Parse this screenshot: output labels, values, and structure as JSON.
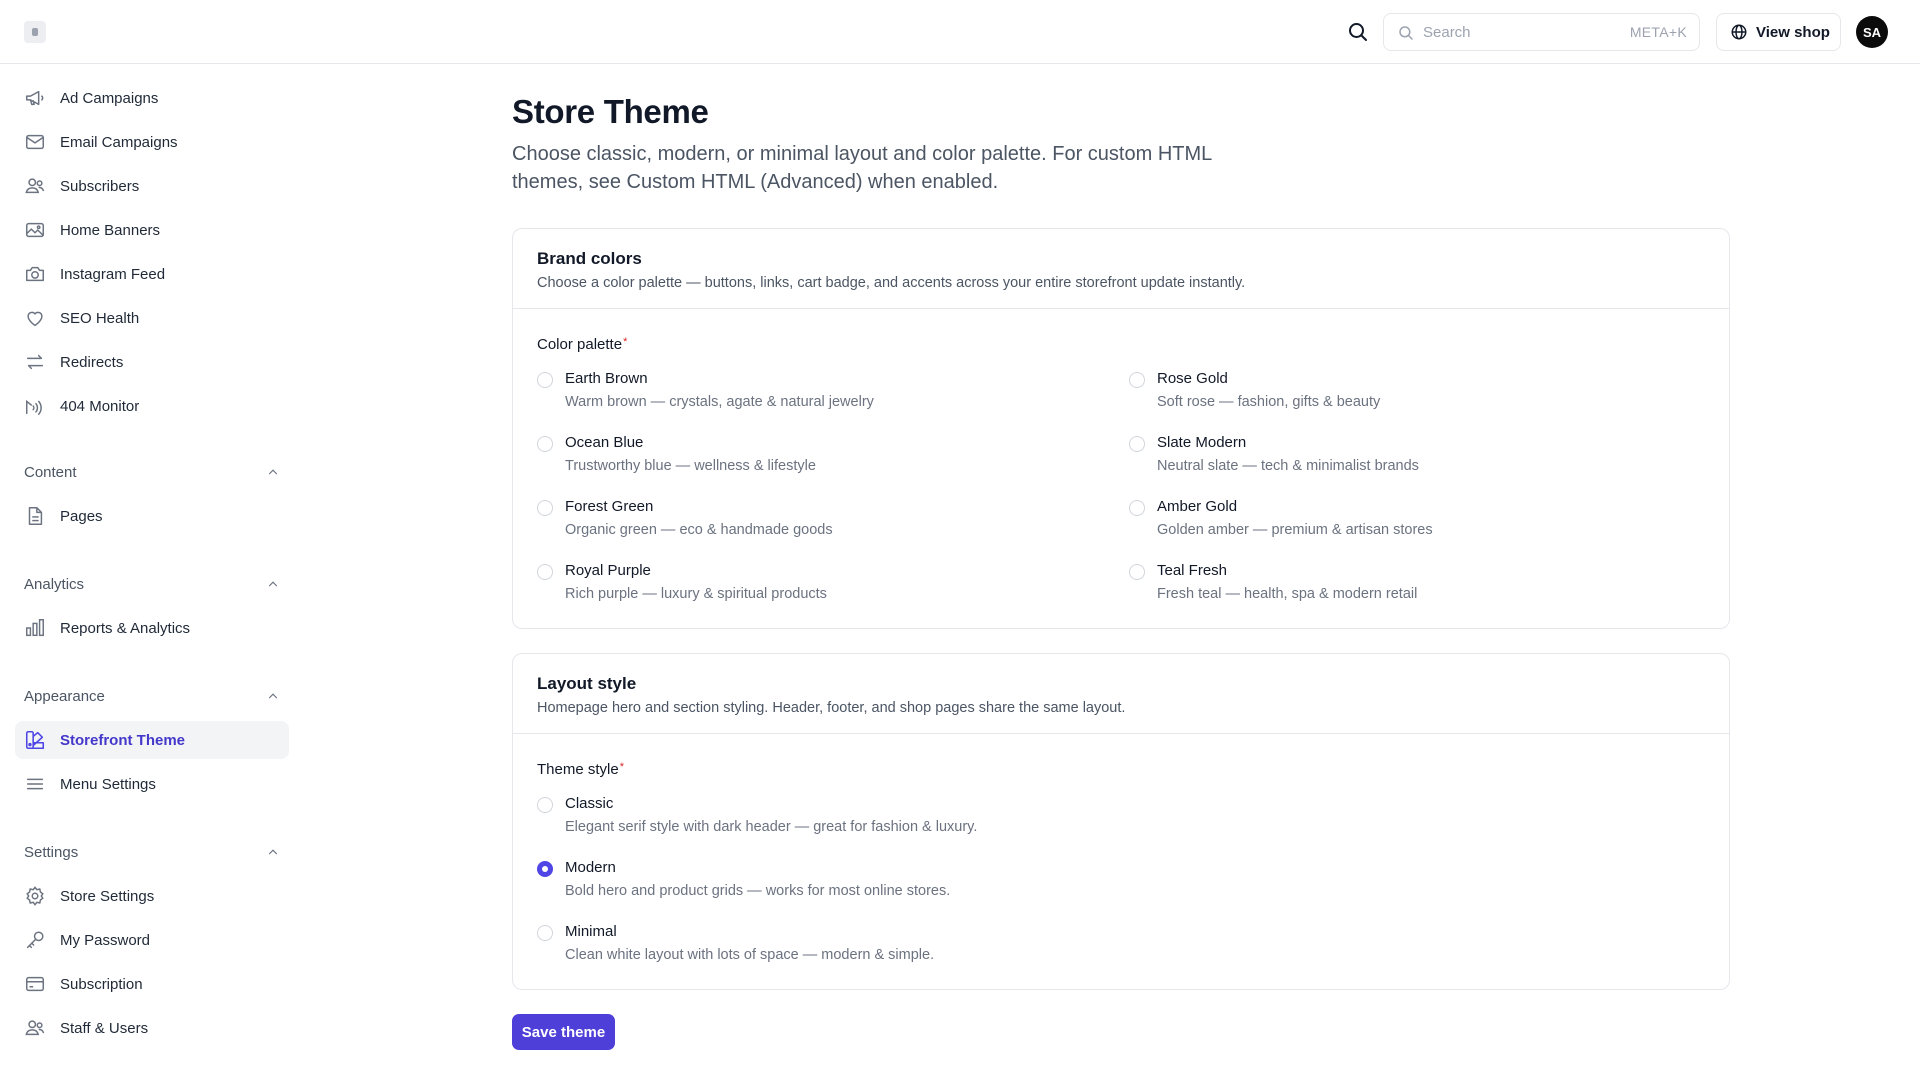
{
  "header": {
    "search_placeholder": "Search",
    "search_shortcut": "META+K",
    "view_shop_label": "View shop",
    "avatar_initials": "SA"
  },
  "sidebar": {
    "top_items": [
      {
        "label": "Ad Campaigns",
        "icon": "megaphone-icon"
      },
      {
        "label": "Email Campaigns",
        "icon": "mail-icon"
      },
      {
        "label": "Subscribers",
        "icon": "users-icon"
      },
      {
        "label": "Home Banners",
        "icon": "image-icon"
      },
      {
        "label": "Instagram Feed",
        "icon": "camera-icon"
      },
      {
        "label": "SEO Health",
        "icon": "heart-icon"
      },
      {
        "label": "Redirects",
        "icon": "arrows-icon"
      },
      {
        "label": "404 Monitor",
        "icon": "radio-waves-icon"
      }
    ],
    "sections": [
      {
        "label": "Content",
        "items": [
          {
            "label": "Pages",
            "icon": "file-icon"
          }
        ]
      },
      {
        "label": "Analytics",
        "items": [
          {
            "label": "Reports & Analytics",
            "icon": "bar-chart-icon"
          }
        ]
      },
      {
        "label": "Appearance",
        "items": [
          {
            "label": "Storefront Theme",
            "icon": "palette-icon",
            "active": true
          },
          {
            "label": "Menu Settings",
            "icon": "menu-icon"
          }
        ]
      },
      {
        "label": "Settings",
        "items": [
          {
            "label": "Store Settings",
            "icon": "gear-icon"
          },
          {
            "label": "My Password",
            "icon": "key-icon"
          },
          {
            "label": "Subscription",
            "icon": "card-icon"
          },
          {
            "label": "Staff & Users",
            "icon": "users-icon"
          }
        ]
      }
    ]
  },
  "page": {
    "title": "Store Theme",
    "subtitle": "Choose classic, modern, or minimal layout and color palette. For custom HTML themes, see Custom HTML (Advanced) when enabled."
  },
  "brand_colors": {
    "title": "Brand colors",
    "description": "Choose a color palette — buttons, links, cart badge, and accents across your entire storefront update instantly.",
    "field_label": "Color palette",
    "required_mark": "*",
    "options": [
      {
        "name": "Earth Brown",
        "desc": "Warm brown — crystals, agate & natural jewelry"
      },
      {
        "name": "Ocean Blue",
        "desc": "Trustworthy blue — wellness & lifestyle"
      },
      {
        "name": "Forest Green",
        "desc": "Organic green — eco & handmade goods"
      },
      {
        "name": "Royal Purple",
        "desc": "Rich purple — luxury & spiritual products"
      },
      {
        "name": "Rose Gold",
        "desc": "Soft rose — fashion, gifts & beauty"
      },
      {
        "name": "Slate Modern",
        "desc": "Neutral slate — tech & minimalist brands"
      },
      {
        "name": "Amber Gold",
        "desc": "Golden amber — premium & artisan stores"
      },
      {
        "name": "Teal Fresh",
        "desc": "Fresh teal — health, spa & modern retail"
      }
    ]
  },
  "layout_style": {
    "title": "Layout style",
    "description": "Homepage hero and section styling. Header, footer, and shop pages share the same layout.",
    "field_label": "Theme style",
    "required_mark": "*",
    "options": [
      {
        "name": "Classic",
        "desc": "Elegant serif style with dark header — great for fashion & luxury.",
        "selected": false
      },
      {
        "name": "Modern",
        "desc": "Bold hero and product grids — works for most online stores.",
        "selected": true
      },
      {
        "name": "Minimal",
        "desc": "Clean white layout with lots of space — modern & simple.",
        "selected": false
      }
    ]
  },
  "save_label": "Save theme",
  "colors": {
    "accent": "#4f46e5",
    "button": "#4f3fd9",
    "active_nav_text": "#4338ca"
  }
}
